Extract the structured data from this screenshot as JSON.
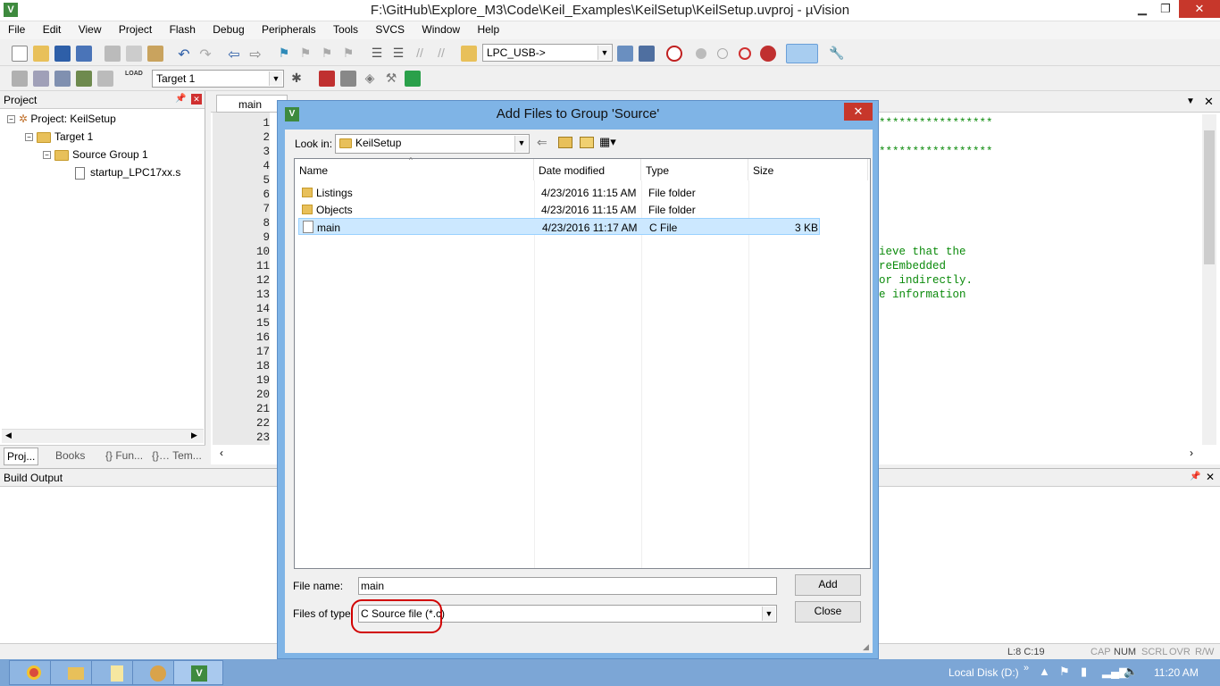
{
  "window": {
    "title": "F:\\GitHub\\Explore_M3\\Code\\Keil_Examples\\KeilSetup\\KeilSetup.uvproj - µVision",
    "minimize": "▁",
    "restore": "❐",
    "close": "✕"
  },
  "menu": [
    "File",
    "Edit",
    "View",
    "Project",
    "Flash",
    "Debug",
    "Peripherals",
    "Tools",
    "SVCS",
    "Window",
    "Help"
  ],
  "toolbar": {
    "debug_combo": "LPC_USB->",
    "target_combo": "Target 1",
    "load_label": "LOAD"
  },
  "project_panel": {
    "title": "Project",
    "project": "Project: KeilSetup",
    "target": "Target 1",
    "group": "Source Group 1",
    "file": "startup_LPC17xx.s",
    "tabs": [
      "Proj...",
      "Books",
      "{} Fun...",
      "{}… Tem..."
    ]
  },
  "editor": {
    "tab": "main",
    "line_numbers": [
      "1",
      "2",
      "3",
      "4",
      "5",
      "6",
      "7",
      "8",
      "9",
      "10",
      "11",
      "12",
      "13",
      "14",
      "15",
      "16",
      "17",
      "18",
      "19",
      "20",
      "21",
      "22",
      "23"
    ],
    "code_lines": {
      "l1": "*****************",
      "l3": "*****************",
      "l10": "ieve that the",
      "l11": "reEmbedded",
      "l12": "or indirectly.",
      "l13": "e information"
    }
  },
  "build_output": {
    "title": "Build Output"
  },
  "dialog": {
    "title": "Add Files to Group 'Source'",
    "look_in_label": "Look in:",
    "look_in_value": "KeilSetup",
    "columns": {
      "name": "Name",
      "date": "Date modified",
      "type": "Type",
      "size": "Size"
    },
    "rows": [
      {
        "name": "Listings",
        "date": "4/23/2016 11:15 AM",
        "type": "File folder",
        "size": "",
        "icon": "folder-icon"
      },
      {
        "name": "Objects",
        "date": "4/23/2016 11:15 AM",
        "type": "File folder",
        "size": "",
        "icon": "folder-icon"
      },
      {
        "name": "main",
        "date": "4/23/2016 11:17 AM",
        "type": "C File",
        "size": "3 KB",
        "icon": "c-file-icon"
      }
    ],
    "file_name_label": "File name:",
    "file_name_value": "main",
    "file_type_label": "Files of type:",
    "file_type_value": "C Source file (*.c)",
    "add_button": "Add",
    "close_button": "Close"
  },
  "status": {
    "position": "L:8 C:19",
    "caps": "CAP",
    "num": "NUM",
    "scrl": "SCRL",
    "ovr": "OVR",
    "rw": "R/W"
  },
  "taskbar": {
    "drive": "Local Disk (D:)",
    "clock": "11:20 AM"
  },
  "colors": {
    "dialog_frame": "#7fb4e6",
    "selection": "#cce8ff",
    "highlight_ring": "#d10000",
    "code_comment": "#0a8a0a"
  }
}
